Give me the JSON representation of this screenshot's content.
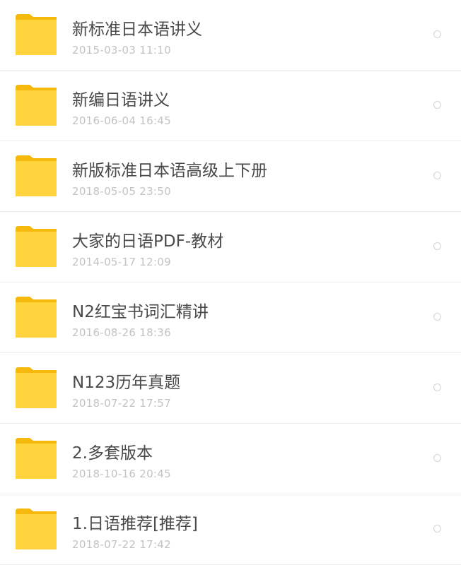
{
  "folders": [
    {
      "name": "新标准日本语讲义",
      "date": "2015-03-03  11:10",
      "icon": "folder-icon"
    },
    {
      "name": "新编日语讲义",
      "date": "2016-06-04  16:45",
      "icon": "folder-icon"
    },
    {
      "name": "新版标准日本语高级上下册",
      "date": "2018-05-05  23:50",
      "icon": "folder-icon"
    },
    {
      "name": "大家的日语PDF-教材",
      "date": "2014-05-17  12:09",
      "icon": "folder-icon"
    },
    {
      "name": "N2红宝书词汇精讲",
      "date": "2016-08-26  18:36",
      "icon": "folder-icon"
    },
    {
      "name": "N123历年真题",
      "date": "2018-07-22  17:57",
      "icon": "folder-icon"
    },
    {
      "name": "2.多套版本",
      "date": "2018-10-16  20:45",
      "icon": "folder-icon"
    },
    {
      "name": "1.日语推荐[推荐]",
      "date": "2018-07-22  17:42",
      "icon": "folder-icon"
    }
  ],
  "colors": {
    "folder_front": "#ffd33c",
    "folder_back": "#f5b90d",
    "name_text": "#4a4a4a",
    "date_text": "#c3c3c3"
  }
}
